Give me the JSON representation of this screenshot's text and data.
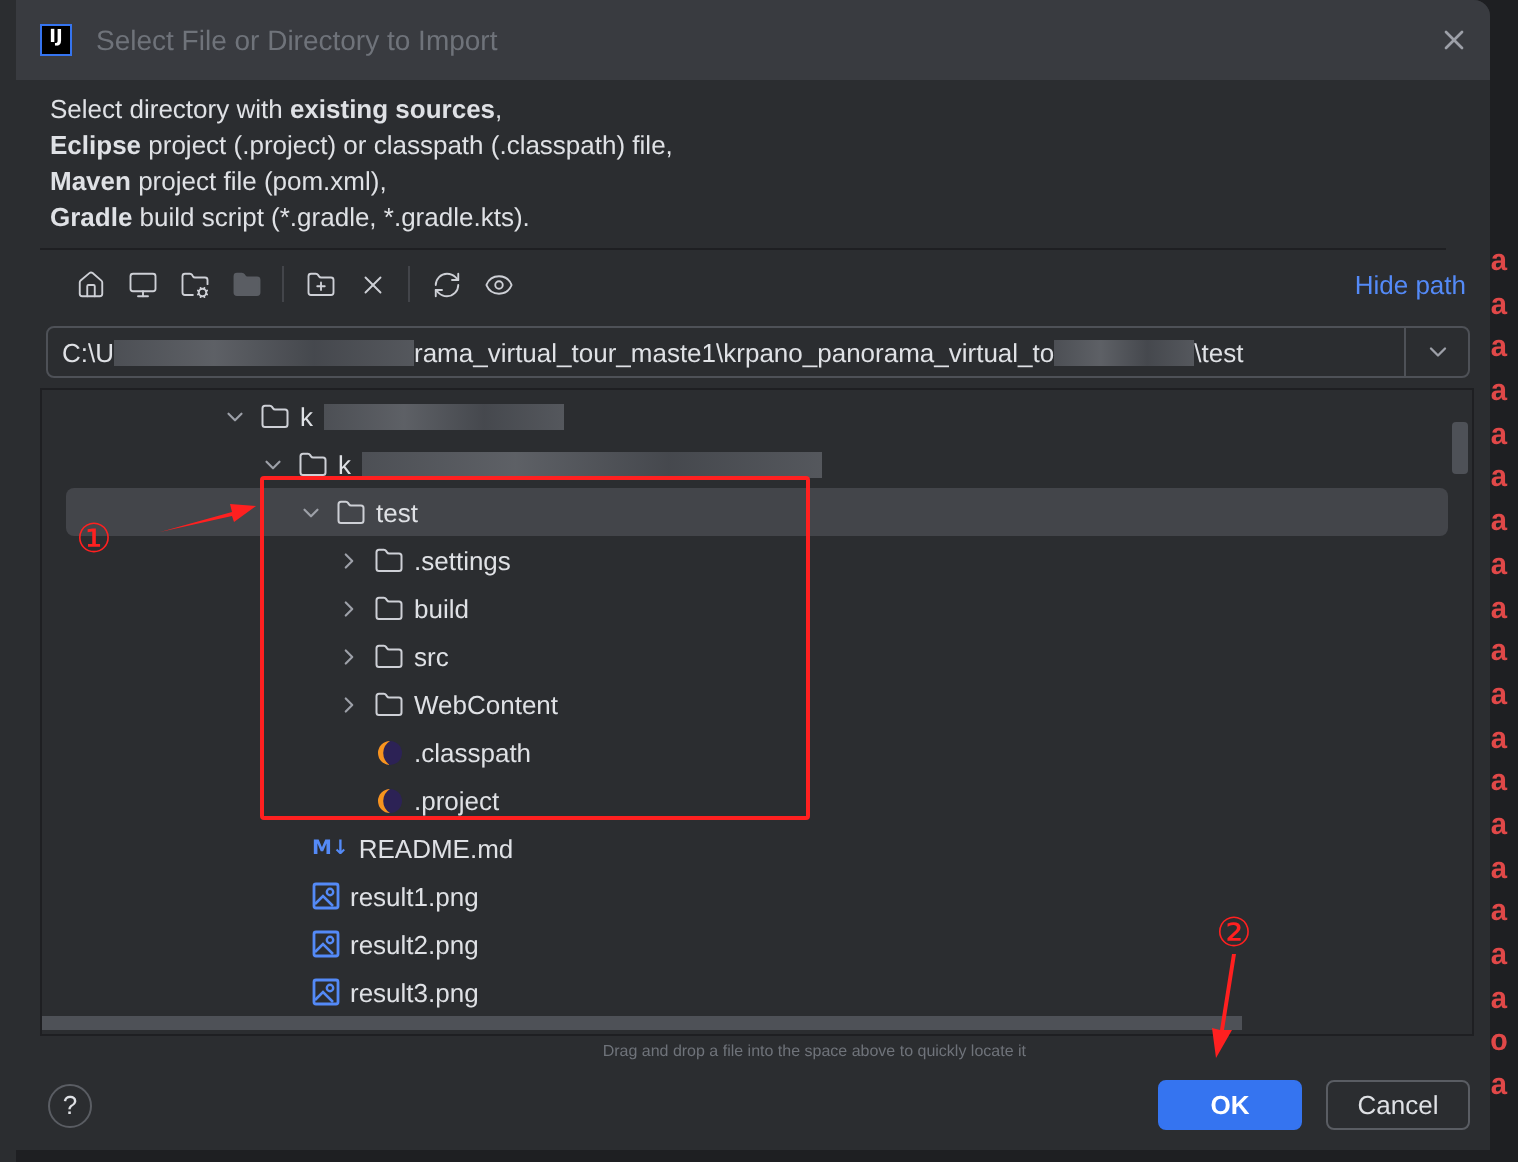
{
  "window": {
    "logo": "IJ",
    "title": "Select File or Directory to Import"
  },
  "description": [
    "Select directory with **existing sources**,",
    "**Eclipse** project (.project) or classpath (.classpath) file,",
    "**Maven** project file (pom.xml),",
    "**Gradle** build script (*.gradle, *.gradle.kts)."
  ],
  "toolbar": [
    {
      "kind": "home",
      "disabled": false
    },
    {
      "kind": "desktop",
      "disabled": false
    },
    {
      "kind": "project",
      "disabled": false
    },
    {
      "kind": "module",
      "disabled": true
    },
    {
      "kind": "separator"
    },
    {
      "kind": "new-folder",
      "disabled": false
    },
    {
      "kind": "delete",
      "disabled": false
    },
    {
      "kind": "separator"
    },
    {
      "kind": "refresh",
      "disabled": false
    },
    {
      "kind": "hidden",
      "disabled": false
    }
  ],
  "hide_path": "Hide path",
  "path": [
    {
      "text": "C:\\U"
    },
    {
      "redacted": true
    },
    {
      "text": "rama_virtual_tour_maste1\\krpano_panorama_virtual_to"
    },
    {
      "redacted": true
    },
    {
      "text": "\\test"
    }
  ],
  "tree": [
    {
      "kind": "folder",
      "label": "k",
      "redacted": true,
      "expanded": true,
      "selected": false,
      "children": [
        {
          "kind": "folder",
          "label": "k",
          "redacted": true,
          "expanded": true,
          "selected": false,
          "children": [
            {
              "kind": "folder",
              "label": "test",
              "expanded": true,
              "selected": true,
              "children": [
                {
                  "kind": "folder",
                  "label": ".settings",
                  "expanded": false,
                  "selected": false
                },
                {
                  "kind": "folder",
                  "label": "build",
                  "expanded": false,
                  "selected": false
                },
                {
                  "kind": "folder",
                  "label": "src",
                  "expanded": false,
                  "selected": false
                },
                {
                  "kind": "folder",
                  "label": "WebContent",
                  "expanded": false,
                  "selected": false
                },
                {
                  "kind": "eclipse",
                  "label": ".classpath",
                  "selected": false
                },
                {
                  "kind": "eclipse",
                  "label": ".project",
                  "selected": false
                }
              ]
            },
            {
              "kind": "markdown",
              "badge": "M↓",
              "label": "README.md",
              "selected": false
            },
            {
              "kind": "image",
              "label": "result1.png",
              "selected": false
            },
            {
              "kind": "image",
              "label": "result2.png",
              "selected": false
            },
            {
              "kind": "image",
              "label": "result3.png",
              "selected": false
            }
          ]
        }
      ]
    }
  ],
  "hint": "Drag and drop a file into the space above to quickly locate it",
  "help": "?",
  "buttons": [
    {
      "label": "OK",
      "primary": true
    },
    {
      "label": "Cancel",
      "primary": false
    }
  ],
  "annotations": [
    "①",
    "②"
  ],
  "console": [
    "a",
    "a",
    "a",
    "a",
    "a",
    "a",
    "a",
    "a",
    "a",
    "a",
    "a",
    "a",
    "a",
    "a",
    "a",
    "a",
    "a",
    "a",
    "o",
    "a"
  ]
}
